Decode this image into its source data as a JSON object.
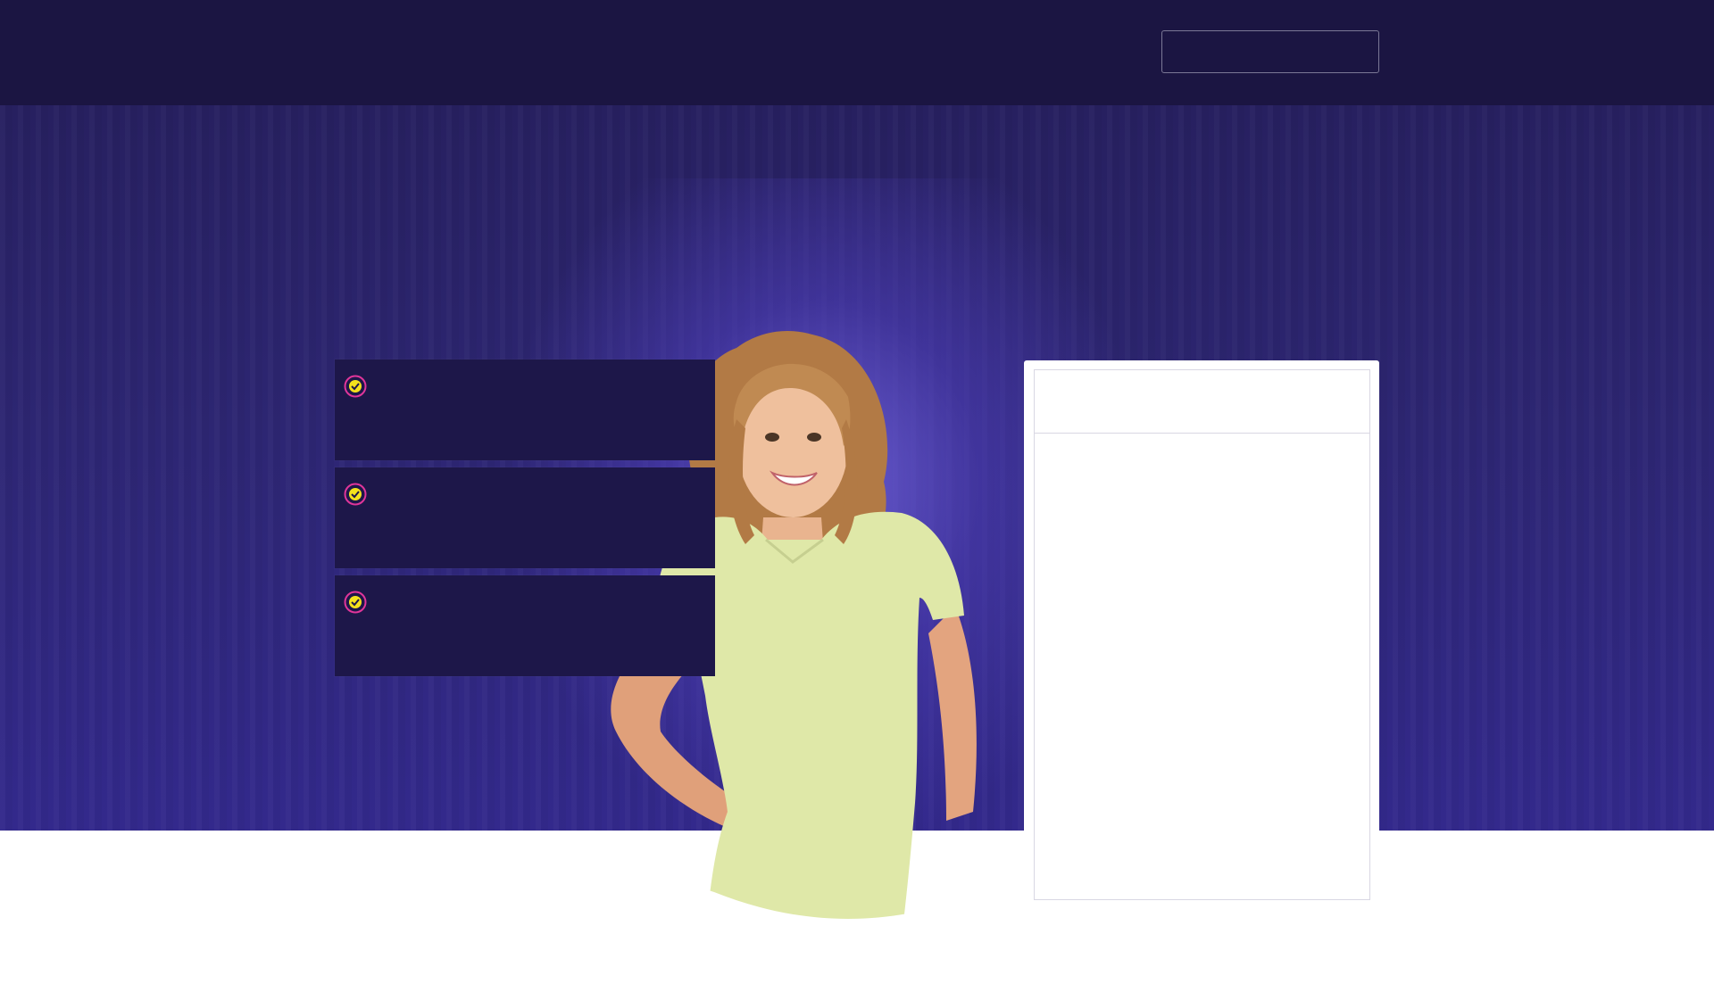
{
  "header": {
    "cta_button_label": ""
  },
  "benefits": [
    {
      "text": "",
      "icon": "check-circle-icon"
    },
    {
      "text": "",
      "icon": "check-circle-icon"
    },
    {
      "text": "",
      "icon": "check-circle-icon"
    }
  ],
  "form": {
    "title": ""
  },
  "colors": {
    "topbar": "#1b1542",
    "hero_top": "#272060",
    "hero_bottom": "#33298c",
    "benefit_bg": "#1d1749",
    "check_ring": "#e0359a",
    "check_fill": "#f4e11c",
    "dress": "#dfe8a8"
  }
}
